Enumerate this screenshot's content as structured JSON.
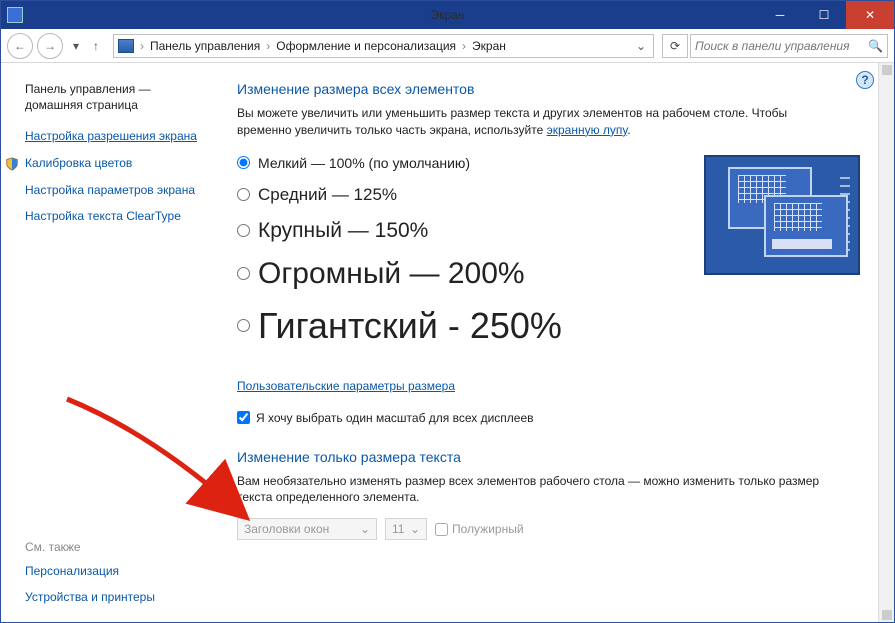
{
  "titlebar": {
    "title": "Экран"
  },
  "nav": {
    "breadcrumb": [
      "Панель управления",
      "Оформление и персонализация",
      "Экран"
    ],
    "search_placeholder": "Поиск в панели управления"
  },
  "sidebar": {
    "cp_home": "Панель управления — домашняя страница",
    "links": [
      {
        "label": "Настройка разрешения экрана",
        "active": true,
        "shield": false
      },
      {
        "label": "Калибровка цветов",
        "active": false,
        "shield": true
      },
      {
        "label": "Настройка параметров экрана",
        "active": false,
        "shield": false
      },
      {
        "label": "Настройка текста ClearType",
        "active": false,
        "shield": false
      }
    ],
    "see_also_heading": "См. также",
    "see_also": [
      "Персонализация",
      "Устройства и принтеры"
    ]
  },
  "main": {
    "heading1": "Изменение размера всех элементов",
    "desc1_a": "Вы можете увеличить или уменьшить размер текста и других элементов на рабочем столе. Чтобы временно увеличить только часть экрана, используйте ",
    "desc1_link": "экранную лупу",
    "desc1_b": ".",
    "sizes": [
      {
        "label": "Мелкий — 100% (по умолчанию)",
        "cls": "m100",
        "checked": true
      },
      {
        "label": "Средний — 125%",
        "cls": "m125",
        "checked": false
      },
      {
        "label": "Крупный — 150%",
        "cls": "m150",
        "checked": false
      },
      {
        "label": "Огромный — 200%",
        "cls": "m200",
        "checked": false
      },
      {
        "label": "Гигантский - 250%",
        "cls": "m250",
        "checked": false
      }
    ],
    "custom_link": "Пользовательские параметры размера",
    "checkbox_label": "Я хочу выбрать один масштаб для всех дисплеев",
    "checkbox_checked": true,
    "heading2": "Изменение только размера текста",
    "desc2": "Вам необязательно изменять размер всех элементов рабочего стола — можно изменить только размер текста определенного элемента.",
    "combo_item": "Заголовки окон",
    "combo_size": "11",
    "bold_label": "Полужирный"
  }
}
